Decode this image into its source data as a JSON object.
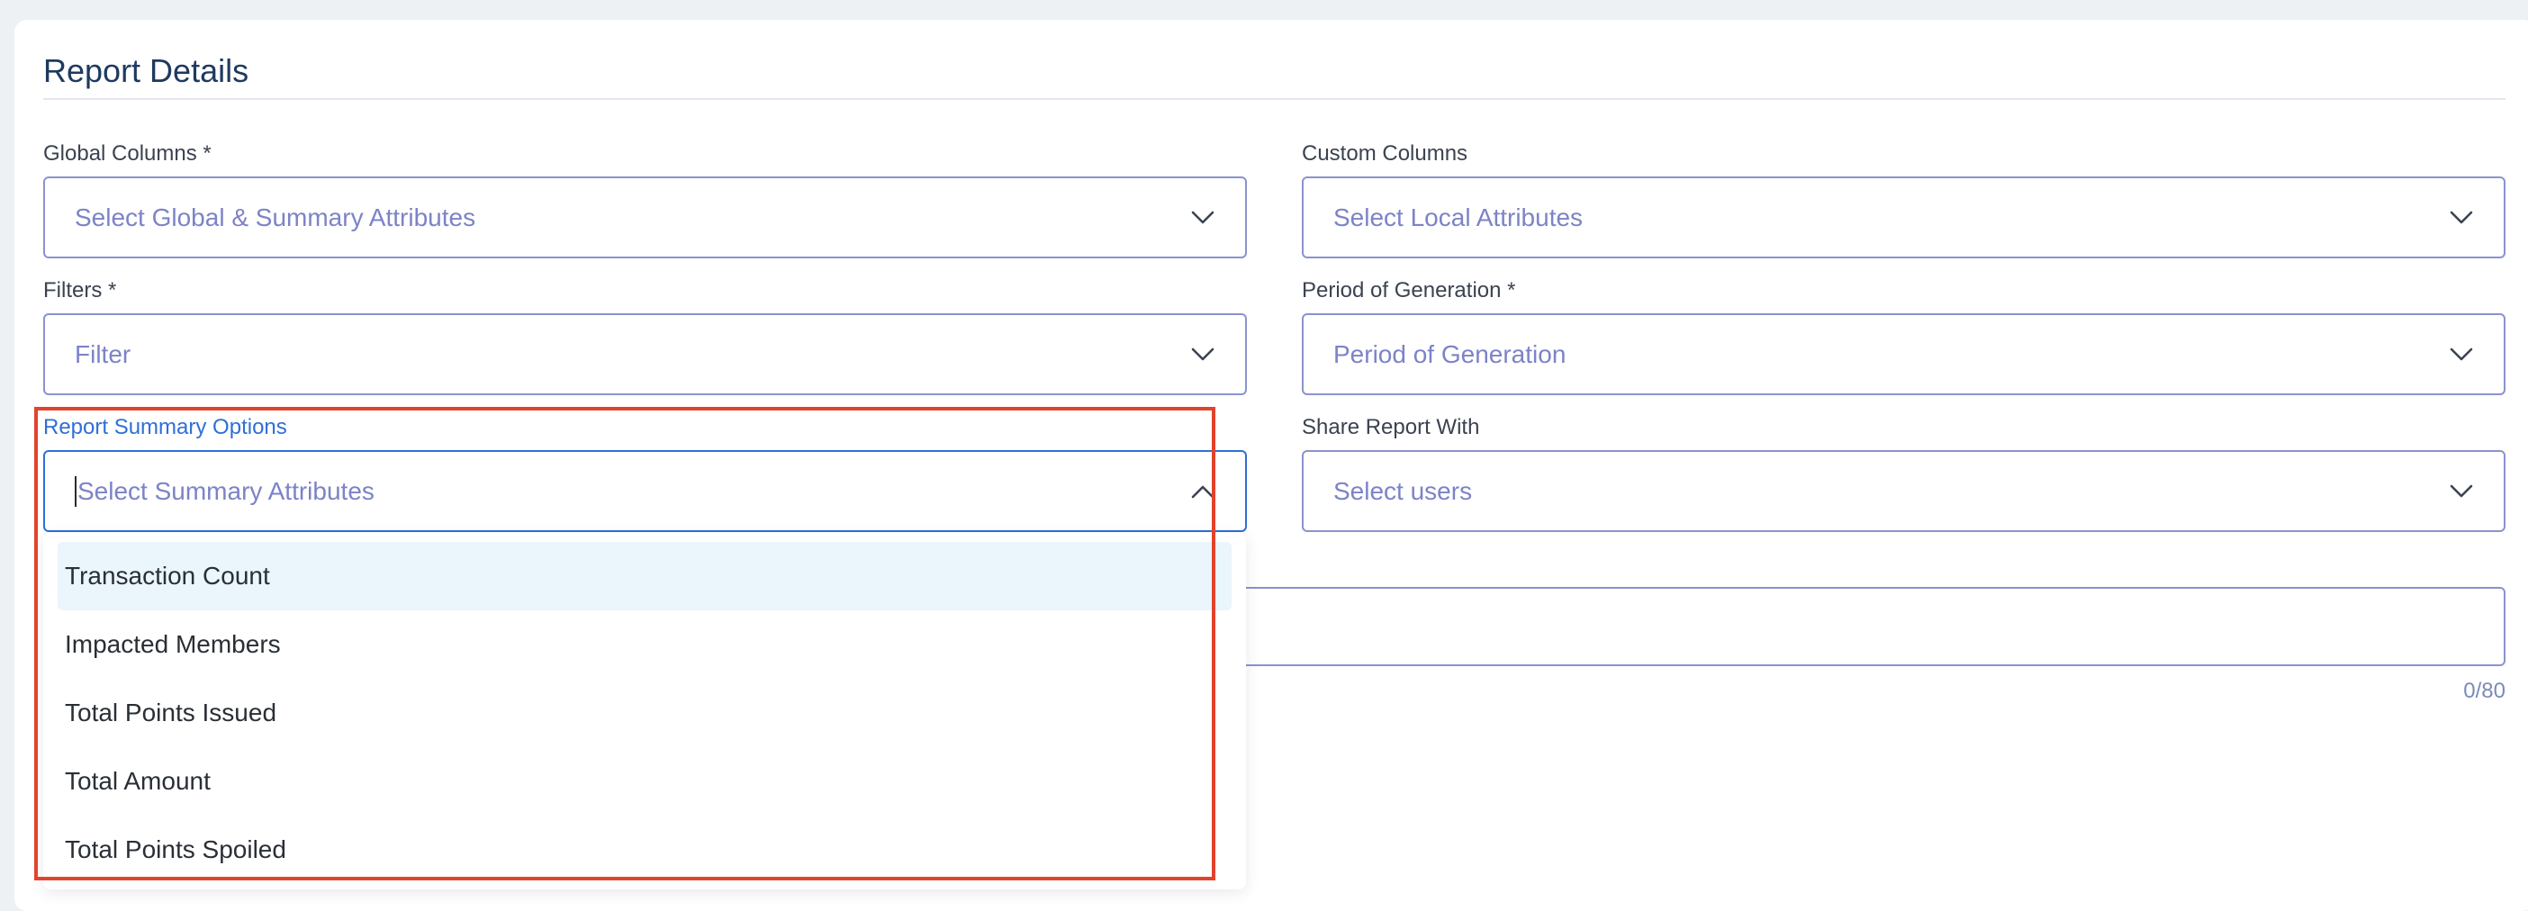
{
  "section": {
    "title": "Report Details"
  },
  "global_columns": {
    "label": "Global Columns *",
    "placeholder": "Select Global & Summary Attributes"
  },
  "custom_columns": {
    "label": "Custom Columns",
    "placeholder": "Select Local Attributes"
  },
  "filters": {
    "label": "Filters *",
    "placeholder": "Filter"
  },
  "period": {
    "label": "Period of Generation *",
    "placeholder": "Period of Generation"
  },
  "summary_options": {
    "label": "Report Summary Options",
    "placeholder": "Select Summary Attributes",
    "options": [
      "Transaction Count",
      "Impacted Members",
      "Total Points Issued",
      "Total Amount",
      "Total Points Spoiled"
    ],
    "hovered_index": 0
  },
  "share_with": {
    "label": "Share Report With",
    "placeholder": "Select users"
  },
  "description": {
    "counter": "0/80"
  },
  "colors": {
    "field_border": "#8a93cf",
    "focus_border": "#2f6fd6",
    "placeholder": "#7c83c7",
    "option_hover": "#eaf5fc",
    "annotation_red": "#e2432c"
  }
}
